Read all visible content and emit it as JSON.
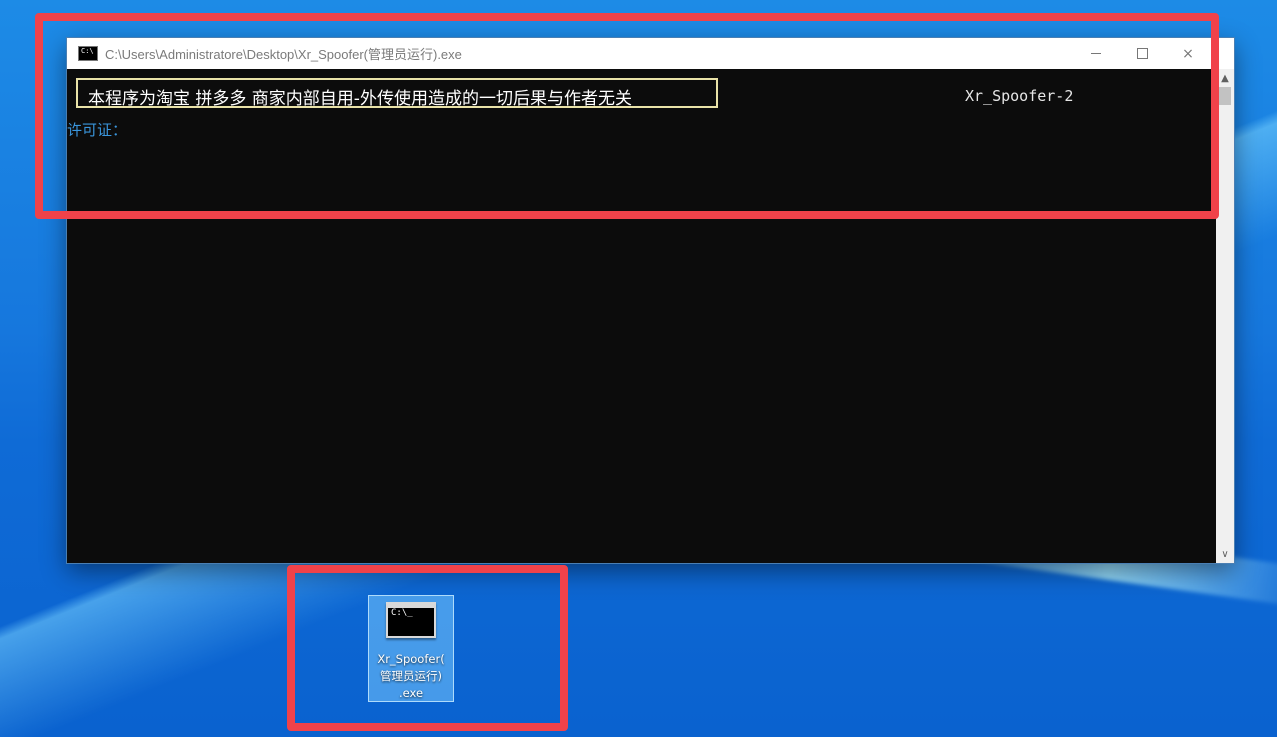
{
  "window": {
    "title": "C:\\Users\\Administratore\\Desktop\\Xr_Spoofer(管理员运行).exe",
    "icon": "console-icon",
    "icon_glyph": "C:\\",
    "controls": {
      "minimize": "minimize-icon",
      "maximize": "maximize-icon",
      "close": "×"
    }
  },
  "console": {
    "banner": "本程序为淘宝 拼多多 商家内部自用-外传使用造成的一切后果与作者无关",
    "version": "Xr_Spoofer-2",
    "license_label": "许可证：",
    "colors": {
      "background": "#0c0c0c",
      "banner_border": "#e9e2a8",
      "license_text": "#3a96dd"
    }
  },
  "desktop_icon": {
    "icon": "console-exe-icon",
    "prompt": "C:\\_",
    "label_lines": [
      "Xr_Spoofer(",
      "管理员运行)",
      ".exe"
    ]
  },
  "highlights": {
    "color": "#f0424a"
  }
}
